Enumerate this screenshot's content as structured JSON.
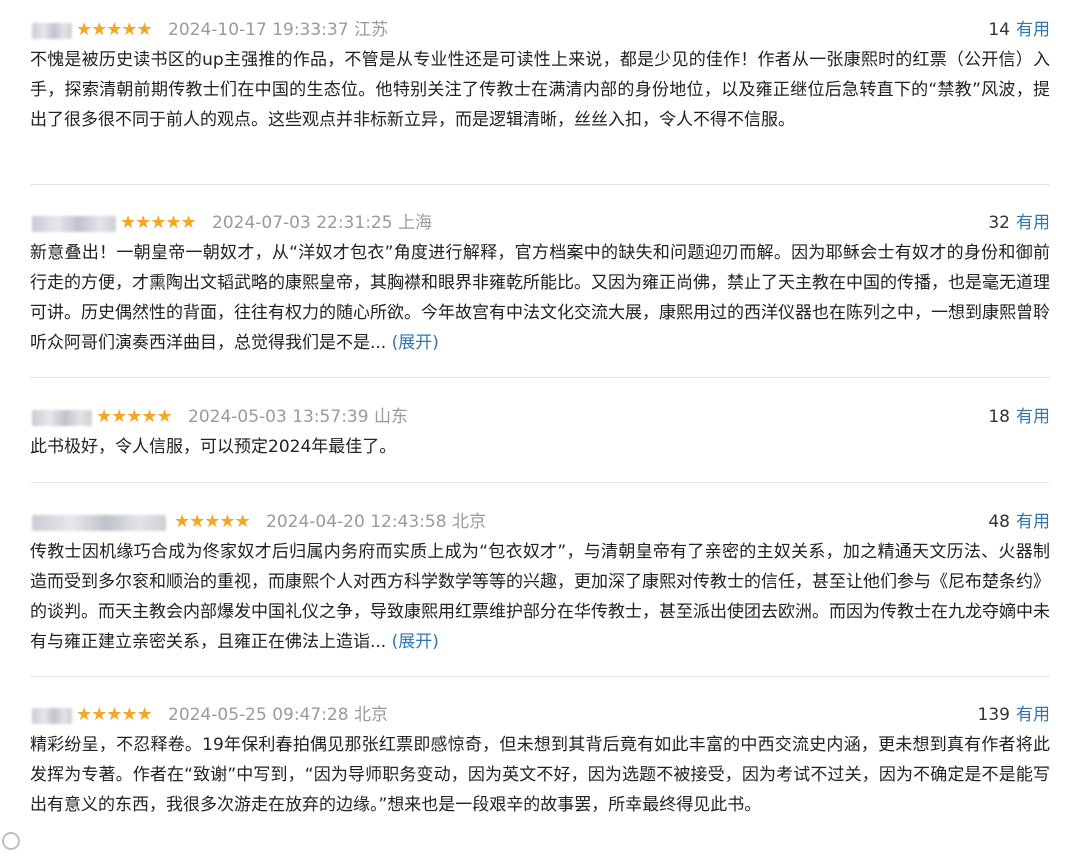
{
  "reviews": [
    {
      "rating": "★★★★★",
      "datetime": "2024-10-17 19:33:37",
      "location": "江苏",
      "votes": "14",
      "useful_label": "有用",
      "text": "不愧是被历史读书区的up主强推的作品，不管是从专业性还是可读性上来说，都是少见的佳作！作者从一张康熙时的红票（公开信）入手，探索清朝前期传教士们在中国的生态位。他特别关注了传教士在满清内部的身份地位，以及雍正继位后急转直下的“禁教”风波，提出了很多很不同于前人的观点。这些观点并非标新立异，而是逻辑清晰，丝丝入扣，令人不得不信服。",
      "expand": ""
    },
    {
      "rating": "★★★★★",
      "datetime": "2024-07-03 22:31:25",
      "location": "上海",
      "votes": "32",
      "useful_label": "有用",
      "text": "新意叠出！一朝皇帝一朝奴才，从“洋奴才包衣”角度进行解释，官方档案中的缺失和问题迎刃而解。因为耶稣会士有奴才的身份和御前行走的方便，才熏陶出文韬武略的康熙皇帝，其胸襟和眼界非雍乾所能比。又因为雍正尚佛，禁止了天主教在中国的传播，也是毫无道理可讲。历史偶然性的背面，往往有权力的随心所欲。今年故宫有中法文化交流大展，康熙用过的西洋仪器也在陈列之中，一想到康熙曾聆听众阿哥们演奏西洋曲目，总觉得我们是不是... ",
      "expand": "(展开)"
    },
    {
      "rating": "★★★★★",
      "datetime": "2024-05-03 13:57:39",
      "location": "山东",
      "votes": "18",
      "useful_label": "有用",
      "text": "此书极好，令人信服，可以预定2024年最佳了。",
      "expand": ""
    },
    {
      "rating": "★★★★★",
      "datetime": "2024-04-20 12:43:58",
      "location": "北京",
      "votes": "48",
      "useful_label": "有用",
      "text": "传教士因机缘巧合成为佟家奴才后归属内务府而实质上成为“包衣奴才”，与清朝皇帝有了亲密的主奴关系，加之精通天文历法、火器制造而受到多尔衮和顺治的重视，而康熙个人对西方科学数学等等的兴趣，更加深了康熙对传教士的信任，甚至让他们参与《尼布楚条约》的谈判。而天主教会内部爆发中国礼仪之争，导致康熙用红票维护部分在华传教士，甚至派出使团去欧洲。而因为传教士在九龙夺嫡中未有与雍正建立亲密关系，且雍正在佛法上造诣... ",
      "expand": "(展开)"
    },
    {
      "rating": "★★★★★",
      "datetime": "2024-05-25 09:47:28",
      "location": "北京",
      "votes": "139",
      "useful_label": "有用",
      "text": "精彩纷呈，不忍释卷。19年保利春拍偶见那张红票即感惊奇，但未想到其背后竟有如此丰富的中西交流史内涵，更未想到真有作者将此发挥为专著。作者在“致谢”中写到，“因为导师职务变动，因为英文不好，因为选题不被接受，因为考试不过关，因为不确定是不是能写出有意义的东西，我很多次游走在放弃的边缘。”想来也是一段艰辛的故事罢，所幸最终得见此书。",
      "expand": ""
    }
  ]
}
